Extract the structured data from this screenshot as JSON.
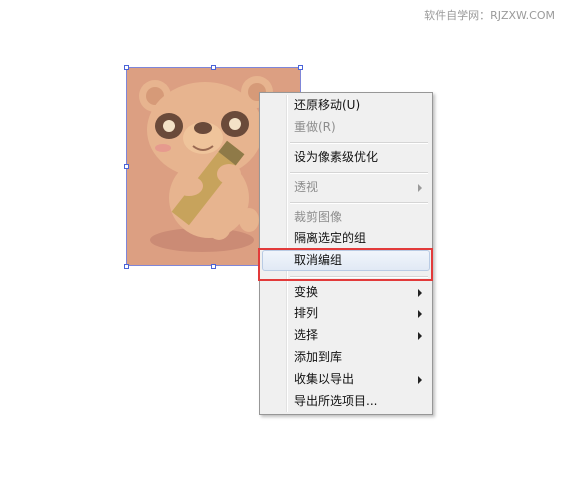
{
  "watermark": "软件自学网：RJZXW.COM",
  "artwork": {
    "icon": "bear-with-pencil-image",
    "background_color": "#dc9f82"
  },
  "menu": {
    "items": [
      {
        "label": "还原移动(U)",
        "disabled": false,
        "submenu": false
      },
      {
        "label": "重做(R)",
        "disabled": true,
        "submenu": false
      },
      {
        "label": "设为像素级优化",
        "disabled": false,
        "submenu": false
      },
      {
        "label": "透视",
        "disabled": true,
        "submenu": true
      },
      {
        "label": "裁剪图像",
        "disabled": true,
        "submenu": false
      },
      {
        "label": "隔离选定的组",
        "disabled": false,
        "submenu": false
      },
      {
        "label": "取消编组",
        "disabled": false,
        "submenu": false
      },
      {
        "label": "变换",
        "disabled": false,
        "submenu": true
      },
      {
        "label": "排列",
        "disabled": false,
        "submenu": true
      },
      {
        "label": "选择",
        "disabled": false,
        "submenu": true
      },
      {
        "label": "添加到库",
        "disabled": false,
        "submenu": false
      },
      {
        "label": "收集以导出",
        "disabled": false,
        "submenu": true
      },
      {
        "label": "导出所选项目...",
        "disabled": false,
        "submenu": false
      }
    ]
  },
  "colors": {
    "highlight": "#e23a3a",
    "selection": "#4a63d8",
    "hover_border": "#b9cbe4"
  }
}
